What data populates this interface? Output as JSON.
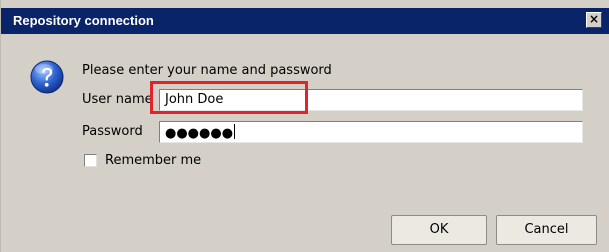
{
  "window": {
    "title": "Repository connection",
    "close_glyph": "×"
  },
  "form": {
    "prompt": "Please enter your name and password",
    "username_label": "User name",
    "username_value": "John Doe",
    "password_label": "Password",
    "password_masked": "●●●●●●",
    "remember_label": "Remember me",
    "remember_checked": false
  },
  "buttons": {
    "ok_label": "OK",
    "cancel_label": "Cancel"
  },
  "icons": {
    "help": "question-mark-icon",
    "close": "close-icon",
    "checkbox": "checkbox-unchecked"
  },
  "colors": {
    "titlebar": "#0a246a",
    "dialog_bg": "#d4d0c8",
    "highlight": "#e0242b"
  }
}
